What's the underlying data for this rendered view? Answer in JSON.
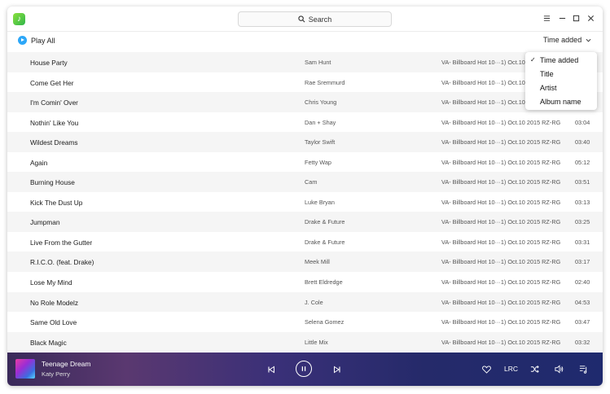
{
  "titlebar": {
    "search_label": "Search"
  },
  "toolbar": {
    "play_all_label": "Play All",
    "sort_label": "Time added"
  },
  "sort_menu": {
    "items": [
      {
        "label": "Time added",
        "checked": true
      },
      {
        "label": "Title",
        "checked": false
      },
      {
        "label": "Artist",
        "checked": false
      },
      {
        "label": "Album name",
        "checked": false
      }
    ]
  },
  "songs": [
    {
      "title": "House Party",
      "artist": "Sam Hunt",
      "album": "VA- Billboard Hot 10···1) Oct.10 2015 RZ-RG",
      "duration": ""
    },
    {
      "title": "Come Get Her",
      "artist": "Rae Sremmurd",
      "album": "VA- Billboard Hot 10···1) Oct.10 2015 RZ-RG",
      "duration": ""
    },
    {
      "title": "I'm Comin' Over",
      "artist": "Chris Young",
      "album": "VA- Billboard Hot 10···1) Oct.10 2015 RZ-RG",
      "duration": ""
    },
    {
      "title": "Nothin' Like You",
      "artist": "Dan + Shay",
      "album": "VA- Billboard Hot 10···1) Oct.10 2015 RZ-RG",
      "duration": "03:04"
    },
    {
      "title": "Wildest Dreams",
      "artist": "Taylor Swift",
      "album": "VA- Billboard Hot 10···1) Oct.10 2015 RZ-RG",
      "duration": "03:40"
    },
    {
      "title": "Again",
      "artist": "Fetty Wap",
      "album": "VA- Billboard Hot 10···1) Oct.10 2015 RZ-RG",
      "duration": "05:12"
    },
    {
      "title": "Burning House",
      "artist": "Cam",
      "album": "VA- Billboard Hot 10···1) Oct.10 2015 RZ-RG",
      "duration": "03:51"
    },
    {
      "title": "Kick The Dust Up",
      "artist": "Luke Bryan",
      "album": "VA- Billboard Hot 10···1) Oct.10 2015 RZ-RG",
      "duration": "03:13"
    },
    {
      "title": "Jumpman",
      "artist": "Drake & Future",
      "album": "VA- Billboard Hot 10···1) Oct.10 2015 RZ-RG",
      "duration": "03:25"
    },
    {
      "title": "Live From the Gutter",
      "artist": "Drake & Future",
      "album": "VA- Billboard Hot 10···1) Oct.10 2015 RZ-RG",
      "duration": "03:31"
    },
    {
      "title": "R.I.C.O. (feat. Drake)",
      "artist": "Meek Mill",
      "album": "VA- Billboard Hot 10···1) Oct.10 2015 RZ-RG",
      "duration": "03:17"
    },
    {
      "title": "Lose My Mind",
      "artist": "Brett Eldredge",
      "album": "VA- Billboard Hot 10···1) Oct.10 2015 RZ-RG",
      "duration": "02:40"
    },
    {
      "title": "No Role Modelz",
      "artist": "J. Cole",
      "album": "VA- Billboard Hot 10···1) Oct.10 2015 RZ-RG",
      "duration": "04:53"
    },
    {
      "title": "Same Old Love",
      "artist": "Selena Gomez",
      "album": "VA- Billboard Hot 10···1) Oct.10 2015 RZ-RG",
      "duration": "03:47"
    },
    {
      "title": "Black Magic",
      "artist": "Little Mix",
      "album": "VA- Billboard Hot 10···1) Oct.10 2015 RZ-RG",
      "duration": "03:32"
    }
  ],
  "player": {
    "track_title": "Teenage Dream",
    "track_artist": "Katy Perry",
    "lrc_label": "LRC"
  }
}
